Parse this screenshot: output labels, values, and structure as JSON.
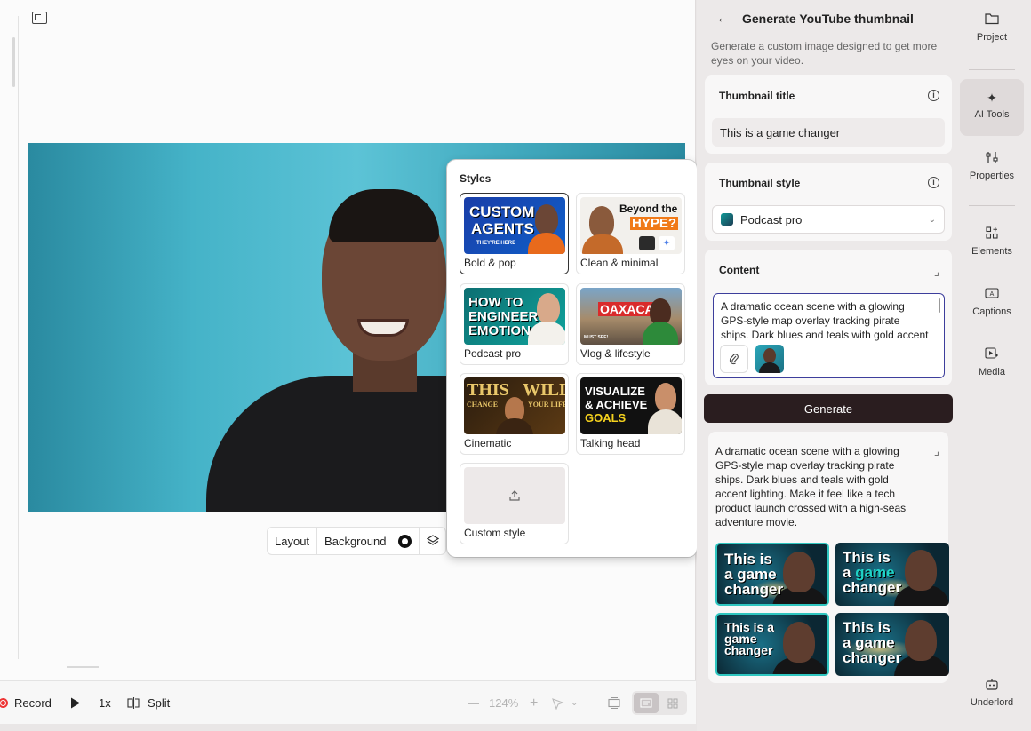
{
  "canvas": {
    "layout_label": "Layout",
    "background_label": "Background"
  },
  "styles": {
    "title": "Styles",
    "items": [
      {
        "label": "Bold & pop",
        "thumb_text": [
          "CUSTOM",
          "AGENTS",
          "THEY'RE HERE"
        ]
      },
      {
        "label": "Clean & minimal",
        "thumb_text": [
          "Beyond the",
          "HYPE?"
        ]
      },
      {
        "label": "Podcast pro",
        "thumb_text": [
          "HOW TO",
          "ENGINEER",
          "EMOTION"
        ]
      },
      {
        "label": "Vlog & lifestyle",
        "thumb_text": [
          "OAXACA",
          "MUST SEE!"
        ]
      },
      {
        "label": "Cinematic",
        "thumb_text": [
          "THIS",
          "WILL",
          "CHANGE",
          "YOUR LIFE"
        ]
      },
      {
        "label": "Talking head",
        "thumb_text": [
          "VISUALIZE",
          "& ACHIEVE",
          "GOALS"
        ]
      },
      {
        "label": "Custom style"
      }
    ]
  },
  "panel": {
    "title": "Generate YouTube thumbnail",
    "description": "Generate a custom image designed to get more eyes on your video.",
    "thumbnail_title_label": "Thumbnail title",
    "thumbnail_title_value": "This is a game changer",
    "thumbnail_style_label": "Thumbnail style",
    "thumbnail_style_value": "Podcast pro",
    "content_label": "Content",
    "content_value": "A dramatic ocean scene with a glowing GPS-style map overlay tracking pirate ships. Dark blues and teals with gold accent lighting. Make it feel like a tech product launch crossed with a high-seas adventure movie.",
    "generate_label": "Generate",
    "result_text": "A dramatic ocean scene with a glowing GPS-style map overlay tracking pirate ships. Dark blues and teals with gold accent lighting. Make it feel like a tech product launch crossed with a high-seas adventure movie.",
    "results": [
      {
        "line1": "This is",
        "line2_pre": "a ",
        "hl": "game",
        "line3": "changer"
      },
      {
        "line1": "This is",
        "line2_pre": "a ",
        "hl": "game",
        "line3": "changer"
      },
      {
        "line1": "This is a",
        "line2_pre": "",
        "hl": "",
        "line2": "game",
        "line3": "changer"
      },
      {
        "line1": "This is",
        "line2_pre": "a ",
        "hl": "",
        "line2": "a game",
        "line3": "changer"
      }
    ]
  },
  "sidebar": {
    "items": [
      {
        "label": "Project",
        "icon": "folder-icon"
      },
      {
        "label": "AI Tools",
        "icon": "sparkle-icon"
      },
      {
        "label": "Properties",
        "icon": "sliders-icon"
      },
      {
        "label": "Elements",
        "icon": "elements-icon"
      },
      {
        "label": "Captions",
        "icon": "captions-icon"
      },
      {
        "label": "Media",
        "icon": "media-icon"
      },
      {
        "label": "Underlord",
        "icon": "robot-icon"
      }
    ]
  },
  "toolbar": {
    "record_label": "Record",
    "speed_label": "1x",
    "split_label": "Split",
    "zoom_label": "124%"
  },
  "colors": {
    "generate_button": "#2a1d1f",
    "selection_border": "#3d3e9c",
    "selected_result_border": "#2fc6c0",
    "record_red": "#e33"
  }
}
